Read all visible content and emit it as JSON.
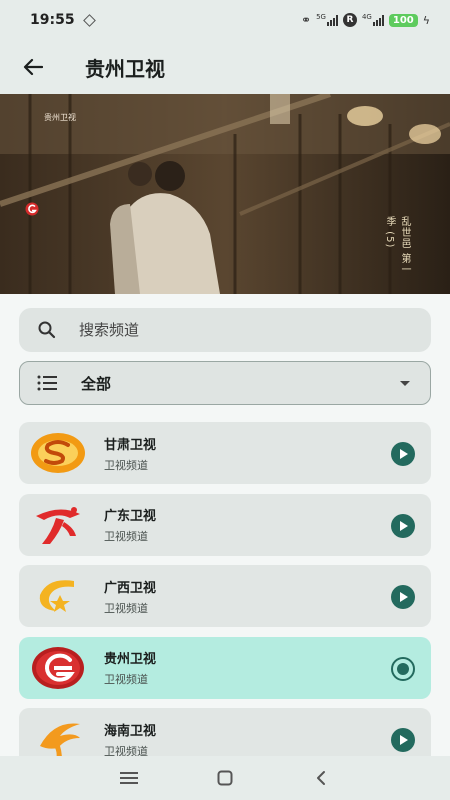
{
  "status_bar": {
    "time": "19:55",
    "network_1": "5G",
    "network_2": "4G",
    "r_badge": "R",
    "battery": "100"
  },
  "app_bar": {
    "title": "贵州卫视"
  },
  "video": {
    "watermark": "贵州卫视",
    "drama_title": "乱世邑 第一季 (5)"
  },
  "search": {
    "placeholder": "搜索频道"
  },
  "category": {
    "selected": "全部"
  },
  "channels": [
    {
      "name": "甘肃卫视",
      "subtitle": "卫视频道",
      "logo": "gansu-logo-icon",
      "active": false
    },
    {
      "name": "广东卫视",
      "subtitle": "卫视频道",
      "logo": "guangdong-logo-icon",
      "active": false
    },
    {
      "name": "广西卫视",
      "subtitle": "卫视频道",
      "logo": "guangxi-logo-icon",
      "active": false
    },
    {
      "name": "贵州卫视",
      "subtitle": "卫视频道",
      "logo": "guizhou-logo-icon",
      "active": true
    },
    {
      "name": "海南卫视",
      "subtitle": "卫视频道",
      "logo": "hainan-logo-icon",
      "active": false
    }
  ],
  "colors": {
    "accent": "#236a5e",
    "active_row": "#b4ece0",
    "surface": "#e1e6e4",
    "battery": "#5ecb5e"
  }
}
